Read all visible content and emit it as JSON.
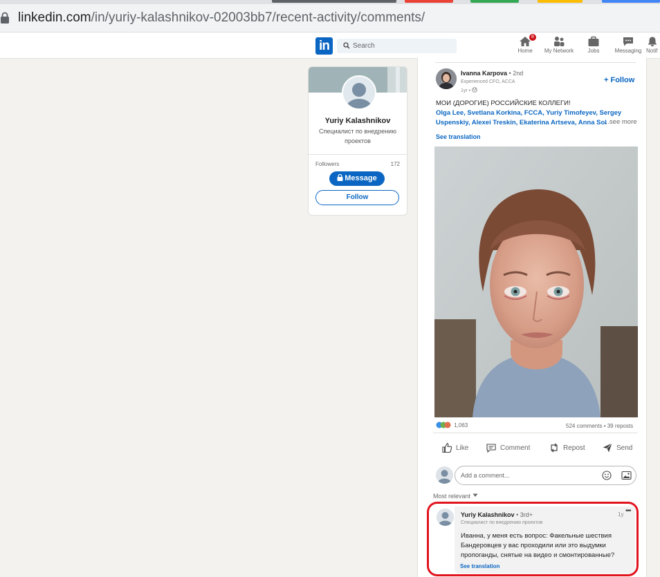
{
  "browser": {
    "url_host": "linkedin.com",
    "url_path": "/in/yuriy-kalashnikov-02003bb7/recent-activity/comments/"
  },
  "nav": {
    "logo": "in",
    "search_placeholder": "Search",
    "home": "Home",
    "home_badge": "8",
    "network": "My Network",
    "jobs": "Jobs",
    "messaging": "Messaging",
    "notifications": "Notif"
  },
  "profile": {
    "name": "Yuriy Kalashnikov",
    "headline": "Специалист по внедрению проектов",
    "followers_label": "Followers",
    "followers_count": "172",
    "message_label": "Message",
    "follow_label": "Follow"
  },
  "post": {
    "author": "Ivanna Karpova",
    "degree": "• 2nd",
    "headline": "Experienced CFO, ACCA",
    "time": "1yr •",
    "follow": "+ Follow",
    "text": "МОИ (ДОРОГИЕ) РОССИЙСКИЕ КОЛЛЕГИ!",
    "mentions": "Olga Lee, Svetlana Korkina, FCCA, Yuriy Timofeyev, Sergey Uspenskiy, Alexei Treskin, Ekaterina Artseva, Anna Sol",
    "see_more": "...see more",
    "see_translation": "See translation",
    "reactions": "1,063",
    "counts": "524 comments • 39 reposts",
    "actions": {
      "like": "Like",
      "comment": "Comment",
      "repost": "Repost",
      "send": "Send"
    },
    "comment_placeholder": "Add a comment...",
    "sort": "Most relevant"
  },
  "comment": {
    "author": "Yuriy Kalashnikov",
    "degree": "• 3rd+",
    "headline": "Специалист по внедрению проектов",
    "time": "1y",
    "text": "Иванна, у меня есть вопрос: Факельные шествия Бандеровцев у вас проходили или это выдумки пропоганды, снятые на видео и смонтированные?",
    "see_translation": "See translation"
  },
  "colors": {
    "brand": "#0a66c2",
    "highlight": "#e1141e",
    "background": "#f3f2ef"
  }
}
